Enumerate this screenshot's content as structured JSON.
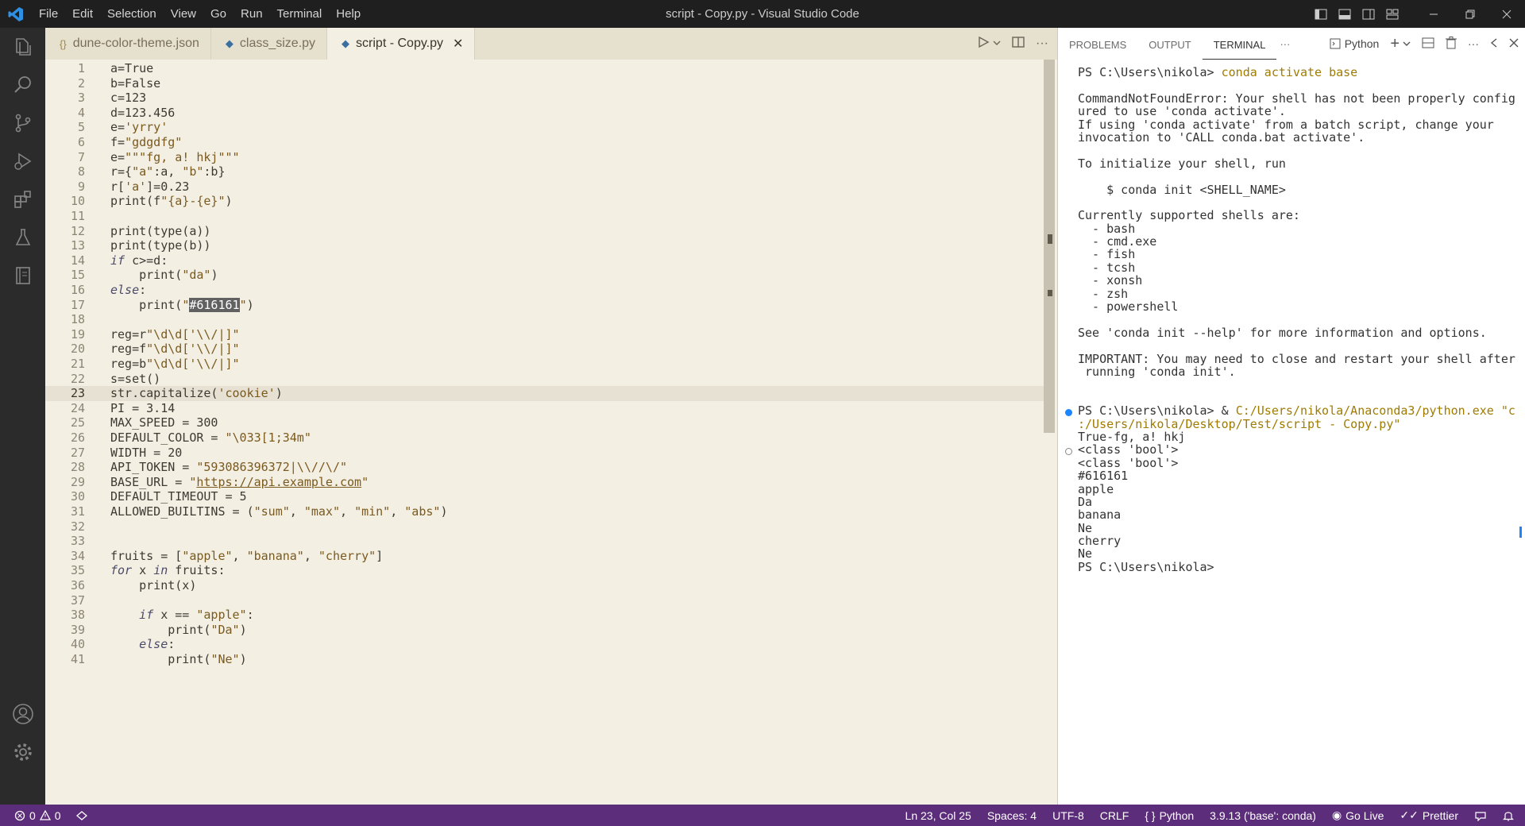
{
  "window": {
    "title": "script - Copy.py - Visual Studio Code",
    "menu": [
      "File",
      "Edit",
      "Selection",
      "View",
      "Go",
      "Run",
      "Terminal",
      "Help"
    ]
  },
  "activity_bar": {
    "icons": [
      "explorer-icon",
      "search-icon",
      "source-control-icon",
      "run-debug-icon",
      "extensions-icon",
      "testing-icon",
      "notebook-icon",
      "account-icon",
      "settings-gear-icon"
    ]
  },
  "tabs": [
    {
      "label": "dune-color-theme.json",
      "icon": "json-icon",
      "active": false
    },
    {
      "label": "class_size.py",
      "icon": "python-icon",
      "active": false
    },
    {
      "label": "script - Copy.py",
      "icon": "python-icon",
      "active": true
    }
  ],
  "editor": {
    "current_line": 23,
    "lines": [
      {
        "n": "1",
        "text": "a=True"
      },
      {
        "n": "2",
        "text": "b=False"
      },
      {
        "n": "3",
        "text": "c=123"
      },
      {
        "n": "4",
        "text": "d=123.456"
      },
      {
        "n": "5",
        "text": "e='yrry'"
      },
      {
        "n": "6",
        "text": "f=\"gdgdfg\""
      },
      {
        "n": "7",
        "text": "e=\"\"\"fg, a! hkj\"\"\""
      },
      {
        "n": "8",
        "text": "r={\"a\":a, \"b\":b}"
      },
      {
        "n": "9",
        "text": "r['a']=0.23"
      },
      {
        "n": "10",
        "text": "print(f\"{a}-{e}\")"
      },
      {
        "n": "11",
        "text": ""
      },
      {
        "n": "12",
        "text": "print(type(a))"
      },
      {
        "n": "13",
        "text": "print(type(b))"
      },
      {
        "n": "14",
        "text": "if c>=d:"
      },
      {
        "n": "15",
        "text": "    print(\"da\")"
      },
      {
        "n": "16",
        "text": "else:"
      },
      {
        "n": "17",
        "text": "    print(\"#616161\")"
      },
      {
        "n": "18",
        "text": ""
      },
      {
        "n": "19",
        "text": "reg=r\"\\d\\d['\\\\/|]\""
      },
      {
        "n": "20",
        "text": "reg=f\"\\d\\d['\\\\/|]\""
      },
      {
        "n": "21",
        "text": "reg=b\"\\d\\d['\\\\/|]\""
      },
      {
        "n": "22",
        "text": "s=set()"
      },
      {
        "n": "23",
        "text": "str.capitalize('cookie')"
      },
      {
        "n": "24",
        "text": "PI = 3.14"
      },
      {
        "n": "25",
        "text": "MAX_SPEED = 300"
      },
      {
        "n": "26",
        "text": "DEFAULT_COLOR = \"\\033[1;34m\""
      },
      {
        "n": "27",
        "text": "WIDTH = 20"
      },
      {
        "n": "28",
        "text": "API_TOKEN = \"593086396372|\\\\//\\/\""
      },
      {
        "n": "29",
        "text": "BASE_URL = \"https://api.example.com\""
      },
      {
        "n": "30",
        "text": "DEFAULT_TIMEOUT = 5"
      },
      {
        "n": "31",
        "text": "ALLOWED_BUILTINS = (\"sum\", \"max\", \"min\", \"abs\")"
      },
      {
        "n": "32",
        "text": ""
      },
      {
        "n": "33",
        "text": ""
      },
      {
        "n": "34",
        "text": "fruits = [\"apple\", \"banana\", \"cherry\"]"
      },
      {
        "n": "35",
        "text": "for x in fruits:"
      },
      {
        "n": "36",
        "text": "    print(x)"
      },
      {
        "n": "37",
        "text": ""
      },
      {
        "n": "38",
        "text": "    if x == \"apple\":"
      },
      {
        "n": "39",
        "text": "        print(\"Da\")"
      },
      {
        "n": "40",
        "text": "    else:"
      },
      {
        "n": "41",
        "text": "        print(\"Ne\")"
      }
    ]
  },
  "panel": {
    "tabs": [
      "PROBLEMS",
      "OUTPUT",
      "TERMINAL"
    ],
    "active_tab": "TERMINAL",
    "terminal_profile": "Python",
    "terminal_lines": [
      {
        "text": "PS C:\\Users\\nikola> ",
        "cmd": "conda activate base"
      },
      {
        "text": ""
      },
      {
        "text": "CommandNotFoundError: Your shell has not been properly config"
      },
      {
        "text": "ured to use 'conda activate'."
      },
      {
        "text": "If using 'conda activate' from a batch script, change your"
      },
      {
        "text": "invocation to 'CALL conda.bat activate'."
      },
      {
        "text": ""
      },
      {
        "text": "To initialize your shell, run"
      },
      {
        "text": ""
      },
      {
        "text": "    $ conda init <SHELL_NAME>"
      },
      {
        "text": ""
      },
      {
        "text": "Currently supported shells are:"
      },
      {
        "text": "  - bash"
      },
      {
        "text": "  - cmd.exe"
      },
      {
        "text": "  - fish"
      },
      {
        "text": "  - tcsh"
      },
      {
        "text": "  - xonsh"
      },
      {
        "text": "  - zsh"
      },
      {
        "text": "  - powershell"
      },
      {
        "text": ""
      },
      {
        "text": "See 'conda init --help' for more information and options."
      },
      {
        "text": ""
      },
      {
        "text": "IMPORTANT: You may need to close and restart your shell after"
      },
      {
        "text": " running 'conda init'."
      },
      {
        "text": ""
      },
      {
        "text": ""
      },
      {
        "text": "PS C:\\Users\\nikola> & ",
        "cmd": "C:/Users/nikola/Anaconda3/python.exe \"c",
        "mark": "blue"
      },
      {
        "text": "",
        "cmd": ":/Users/nikola/Desktop/Test/script - Copy.py\""
      },
      {
        "text": "True-fg, a! hkj"
      },
      {
        "text": "<class 'bool'>",
        "mark": "empty"
      },
      {
        "text": "<class 'bool'>"
      },
      {
        "text": "#616161"
      },
      {
        "text": "apple"
      },
      {
        "text": "Da"
      },
      {
        "text": "banana"
      },
      {
        "text": "Ne"
      },
      {
        "text": "cherry"
      },
      {
        "text": "Ne"
      },
      {
        "text": "PS C:\\Users\\nikola>"
      }
    ]
  },
  "status_bar": {
    "errors": "0",
    "warnings": "0",
    "position": "Ln 23, Col 25",
    "spaces": "Spaces: 4",
    "encoding": "UTF-8",
    "eol": "CRLF",
    "language": "Python",
    "interpreter": "3.9.13 ('base': conda)",
    "go_live": "Go Live",
    "prettier": "Prettier",
    "color": "#5c2d7a"
  }
}
